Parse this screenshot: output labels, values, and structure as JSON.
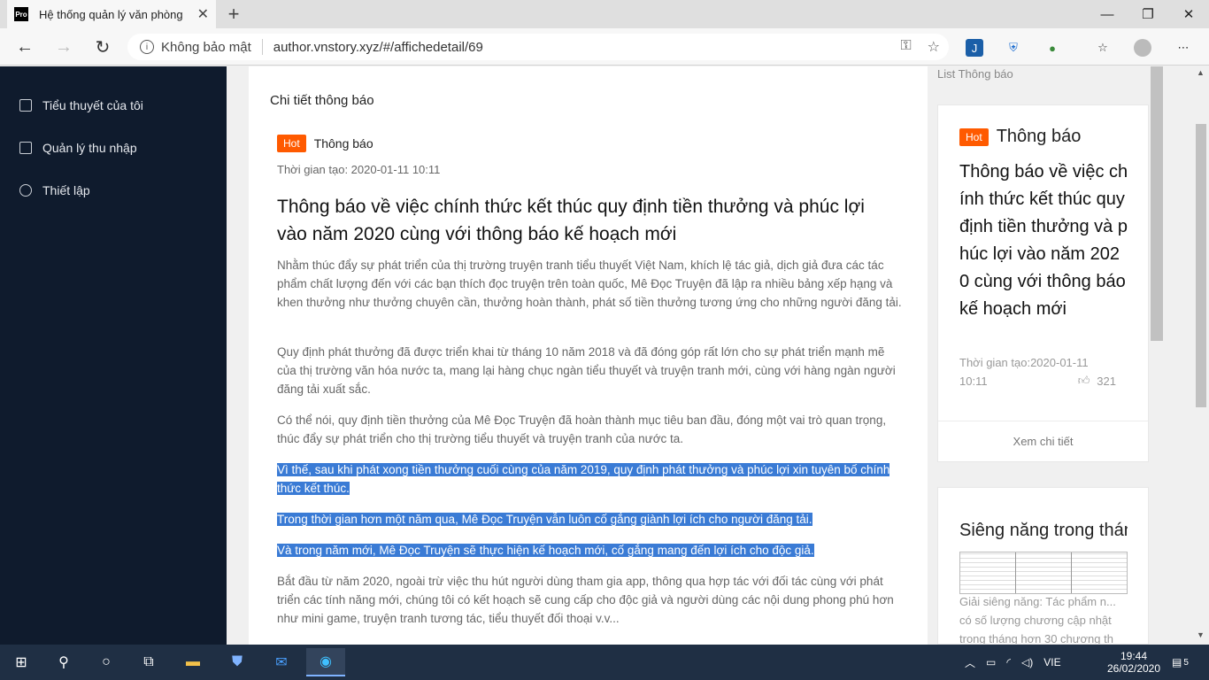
{
  "browser": {
    "tab_title": "Hệ thống quản lý văn phòng",
    "favicon_text": "Pro",
    "security_label": "Không bảo mật",
    "url": "author.vnstory.xyz/#/affichedetail/69"
  },
  "sidebar": {
    "items": [
      {
        "label": "Tiểu thuyết của tôi",
        "icon": "book-icon"
      },
      {
        "label": "Quản lý thu nhập",
        "icon": "wallet-icon"
      },
      {
        "label": "Thiết lập",
        "icon": "gear-icon"
      }
    ]
  },
  "main": {
    "header": "Chi tiết thông báo",
    "badge": "Hot",
    "category": "Thông báo",
    "created_time": "Thời gian tạo:  2020-01-11 10:11",
    "title": "Thông báo về việc chính thức kết thúc quy định tiền thưởng và phúc lợi vào năm 2020 cùng với thông báo kế hoạch mới",
    "paragraphs": [
      "Nhằm thúc đẩy sự phát triển của thị trường truyện tranh tiểu thuyết Việt Nam, khích lệ tác giả, dịch giả đưa các tác phẩm chất lượng đến với các bạn thích đọc truyện trên toàn quốc, Mê Đọc Truyện đã lập ra nhiều bảng xếp hạng và khen thưởng như thưởng chuyên cần, thưởng hoàn thành, phát số tiền thưởng tương ứng cho những người đăng tải.",
      "Quy định phát thưởng đã được triển khai từ tháng 10 năm 2018 và đã đóng góp rất lớn cho sự phát triển mạnh mẽ của thị trường văn hóa nước ta, mang lại hàng chục ngàn tiểu thuyết và truyện tranh mới, cùng với hàng ngàn người đăng tải xuất sắc.",
      "Có thể nói, quy định tiền thưởng của Mê Đọc Truyện đã hoàn thành mục tiêu ban đầu, đóng một vai trò quan trọng, thúc đẩy sự phát triển cho thị trường tiểu thuyết và truyện tranh của nước ta.",
      "Vì thế, sau khi phát xong tiền thưởng cuối cùng của năm 2019, quy định phát thưởng và phúc lợi xin tuyên bố chính thức kết thúc.",
      "Trong thời gian hơn một năm qua, Mê Đọc Truyện vẫn luôn cố gắng giành lợi ích cho người đăng tải.",
      "Và trong năm mới, Mê Đọc Truyện sẽ thực hiện kế hoạch mới, cố gắng mang đến lợi ích cho độc giả.",
      "Bắt đầu từ năm 2020, ngoài trừ việc thu hút người dùng tham gia app, thông qua hợp tác với đối tác cùng với phát triển các tính năng mới, chúng tôi có kết hoạch sẽ cung cấp cho độc giả và người dùng các nội dung phong phú hơn như mini game, truyện tranh tương tác, tiểu thuyết đối thoại v.v..."
    ]
  },
  "right": {
    "label": "List Thông báo",
    "card": {
      "badge": "Hot",
      "category": "Thông báo",
      "title": "Thông báo về việc chính thức kết thúc quy định tiền thưởng và phúc lợi vào năm 2020 cùng với thông báo kế hoạch mới",
      "time": "Thời gian tạo:2020-01-11 10:11",
      "likes": "321",
      "more": "Xem chi tiết"
    },
    "card2": {
      "title": "Siêng năng trong tháng",
      "desc": "Giải siêng năng: Tác phẩm n... có số lượng chương cập nhật trong tháng hơn 30 chương th"
    }
  },
  "taskbar": {
    "lang": "VIE",
    "time": "19:44",
    "date": "26/02/2020",
    "notif_count": "5"
  }
}
